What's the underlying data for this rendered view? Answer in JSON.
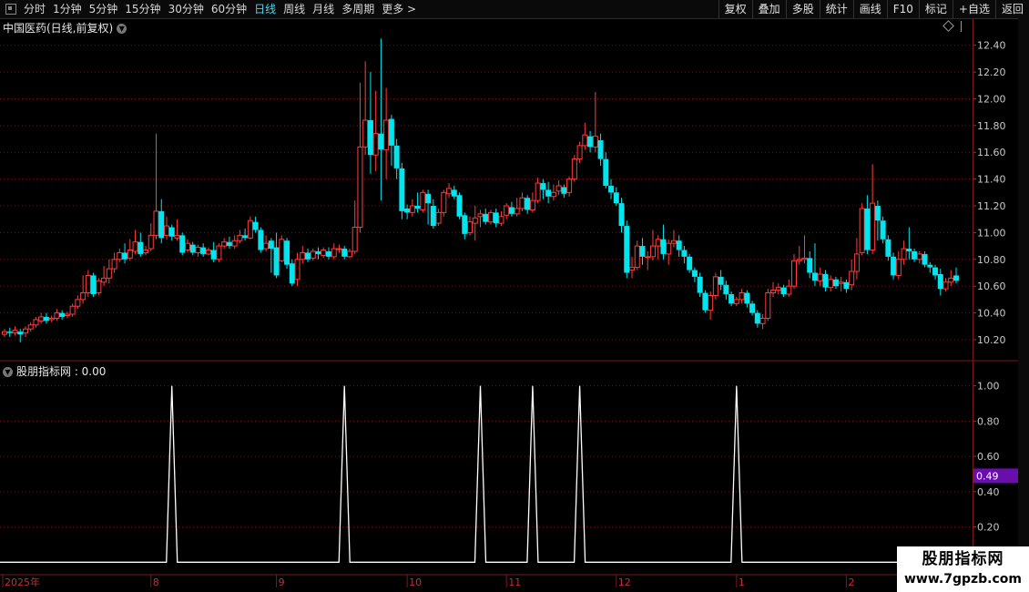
{
  "toolbar": {
    "periods": [
      "分时",
      "1分钟",
      "5分钟",
      "15分钟",
      "30分钟",
      "60分钟",
      "日线",
      "周线",
      "月线",
      "多周期",
      "更多 >"
    ],
    "active_index": 6,
    "buttons": [
      "复权",
      "叠加",
      "多股",
      "统计",
      "画线",
      "F10",
      "标记",
      "+自选",
      "返回"
    ]
  },
  "main_title": "中国医药(日线,前复权)",
  "indicator_title": "股朋指标网 : 0.00",
  "watermark": {
    "line1": "股朋指标网",
    "line2": "www.7gpzb.com"
  },
  "colors": {
    "up": "#ff3c3c",
    "down": "#00e5ee",
    "grid": "#6e1414",
    "signal": "#ffffff",
    "cursor_badge": "#6a0dad"
  },
  "chart_data": [
    {
      "type": "candlestick",
      "y_ticks": [
        "12.40",
        "12.20",
        "12.00",
        "11.80",
        "11.60",
        "11.40",
        "11.20",
        "11.00",
        "10.80",
        "10.60",
        "10.40",
        "10.20"
      ],
      "ylim": [
        10.05,
        12.5
      ],
      "candles": [
        [
          10.24,
          10.26,
          10.28,
          10.22
        ],
        [
          10.26,
          10.25,
          10.29,
          10.22
        ],
        [
          10.25,
          10.27,
          10.3,
          10.23
        ],
        [
          10.26,
          10.24,
          10.28,
          10.18
        ],
        [
          10.25,
          10.28,
          10.3,
          10.22
        ],
        [
          10.28,
          10.31,
          10.33,
          10.26
        ],
        [
          10.31,
          10.35,
          10.37,
          10.29
        ],
        [
          10.34,
          10.37,
          10.4,
          10.32
        ],
        [
          10.37,
          10.34,
          10.4,
          10.32
        ],
        [
          10.35,
          10.36,
          10.38,
          10.33
        ],
        [
          10.36,
          10.4,
          10.43,
          10.34
        ],
        [
          10.4,
          10.37,
          10.42,
          10.35
        ],
        [
          10.38,
          10.39,
          10.41,
          10.36
        ],
        [
          10.39,
          10.45,
          10.47,
          10.37
        ],
        [
          10.45,
          10.5,
          10.53,
          10.43
        ],
        [
          10.5,
          10.55,
          10.68,
          10.47
        ],
        [
          10.55,
          10.68,
          10.72,
          10.52
        ],
        [
          10.68,
          10.54,
          10.7,
          10.52
        ],
        [
          10.55,
          10.64,
          10.66,
          10.53
        ],
        [
          10.63,
          10.66,
          10.75,
          10.6
        ],
        [
          10.66,
          10.73,
          10.8,
          10.62
        ],
        [
          10.73,
          10.8,
          10.85,
          10.7
        ],
        [
          10.8,
          10.85,
          10.88,
          10.78
        ],
        [
          10.85,
          10.8,
          10.92,
          10.77
        ],
        [
          10.81,
          10.87,
          10.95,
          10.79
        ],
        [
          10.86,
          10.93,
          11.02,
          10.84
        ],
        [
          10.93,
          10.84,
          11.0,
          10.82
        ],
        [
          10.85,
          10.87,
          10.9,
          10.83
        ],
        [
          10.88,
          10.98,
          11.07,
          10.86
        ],
        [
          10.98,
          11.16,
          11.74,
          10.95
        ],
        [
          11.16,
          10.96,
          11.25,
          10.92
        ],
        [
          10.98,
          11.05,
          11.12,
          10.95
        ],
        [
          11.04,
          10.97,
          11.06,
          10.94
        ],
        [
          10.96,
          10.98,
          11.1,
          10.94
        ],
        [
          10.98,
          10.85,
          11.0,
          10.83
        ],
        [
          10.87,
          10.92,
          10.95,
          10.85
        ],
        [
          10.91,
          10.85,
          10.93,
          10.83
        ],
        [
          10.85,
          10.89,
          10.91,
          10.82
        ],
        [
          10.89,
          10.84,
          10.92,
          10.82
        ],
        [
          10.84,
          10.87,
          10.89,
          10.83
        ],
        [
          10.87,
          10.8,
          10.93,
          10.78
        ],
        [
          10.8,
          10.9,
          10.92,
          10.78
        ],
        [
          10.9,
          10.93,
          10.96,
          10.88
        ],
        [
          10.93,
          10.9,
          10.97,
          10.88
        ],
        [
          10.9,
          10.94,
          10.98,
          10.88
        ],
        [
          10.94,
          10.98,
          11.02,
          10.92
        ],
        [
          10.98,
          10.96,
          11.03,
          10.94
        ],
        [
          10.96,
          11.09,
          11.12,
          10.95
        ],
        [
          11.08,
          11.02,
          11.12,
          11.0
        ],
        [
          11.02,
          10.87,
          11.04,
          10.85
        ],
        [
          10.88,
          10.92,
          10.98,
          10.86
        ],
        [
          10.94,
          10.88,
          10.96,
          10.7
        ],
        [
          10.89,
          10.68,
          11.0,
          10.66
        ],
        [
          10.79,
          10.95,
          10.98,
          10.78
        ],
        [
          10.94,
          10.76,
          10.96,
          10.73
        ],
        [
          10.77,
          10.62,
          10.8,
          10.6
        ],
        [
          10.65,
          10.8,
          10.85,
          10.6
        ],
        [
          10.8,
          10.85,
          10.9,
          10.77
        ],
        [
          10.85,
          10.8,
          10.88,
          10.78
        ],
        [
          10.81,
          10.86,
          10.88,
          10.79
        ],
        [
          10.86,
          10.84,
          10.89,
          10.8
        ],
        [
          10.83,
          10.87,
          10.89,
          10.81
        ],
        [
          10.86,
          10.82,
          10.89,
          10.8
        ],
        [
          10.82,
          10.88,
          10.92,
          10.8
        ],
        [
          10.88,
          10.88,
          10.91,
          10.85
        ],
        [
          10.88,
          10.82,
          10.9,
          10.8
        ],
        [
          10.82,
          10.86,
          10.88,
          10.81
        ],
        [
          10.86,
          11.04,
          11.24,
          10.84
        ],
        [
          11.04,
          11.64,
          12.12,
          11.0
        ],
        [
          11.64,
          11.84,
          12.28,
          11.58
        ],
        [
          11.84,
          11.58,
          12.2,
          11.44
        ],
        [
          11.58,
          11.74,
          12.06,
          11.46
        ],
        [
          11.74,
          11.62,
          12.45,
          11.24
        ],
        [
          11.62,
          11.84,
          12.08,
          11.4
        ],
        [
          11.85,
          11.65,
          11.88,
          11.5
        ],
        [
          11.65,
          11.48,
          11.7,
          11.4
        ],
        [
          11.48,
          11.16,
          11.52,
          11.1
        ],
        [
          11.18,
          11.15,
          11.21,
          11.1
        ],
        [
          11.15,
          11.2,
          11.25,
          11.12
        ],
        [
          11.2,
          11.18,
          11.3,
          11.15
        ],
        [
          11.17,
          11.3,
          11.32,
          11.15
        ],
        [
          11.29,
          11.22,
          11.32,
          11.06
        ],
        [
          11.2,
          11.05,
          11.25,
          11.03
        ],
        [
          11.07,
          11.15,
          11.18,
          11.05
        ],
        [
          11.15,
          11.3,
          11.32,
          11.12
        ],
        [
          11.29,
          11.33,
          11.37,
          11.26
        ],
        [
          11.32,
          11.27,
          11.35,
          11.25
        ],
        [
          11.28,
          11.12,
          11.3,
          11.1
        ],
        [
          11.13,
          10.99,
          11.15,
          10.95
        ],
        [
          11.0,
          11.08,
          11.12,
          10.98
        ],
        [
          11.07,
          11.11,
          11.2,
          10.94
        ],
        [
          11.12,
          11.14,
          11.17,
          11.04
        ],
        [
          11.14,
          11.08,
          11.18,
          11.06
        ],
        [
          11.08,
          11.15,
          11.17,
          11.06
        ],
        [
          11.15,
          11.07,
          11.18,
          11.04
        ],
        [
          11.07,
          11.12,
          11.16,
          11.05
        ],
        [
          11.13,
          11.2,
          11.22,
          11.1
        ],
        [
          11.19,
          11.14,
          11.23,
          11.12
        ],
        [
          11.14,
          11.18,
          11.26,
          11.12
        ],
        [
          11.18,
          11.26,
          11.3,
          11.16
        ],
        [
          11.26,
          11.17,
          11.28,
          11.14
        ],
        [
          11.17,
          11.24,
          11.3,
          11.15
        ],
        [
          11.24,
          11.37,
          11.41,
          11.22
        ],
        [
          11.37,
          11.32,
          11.4,
          11.25
        ],
        [
          11.32,
          11.27,
          11.38,
          11.22
        ],
        [
          11.27,
          11.3,
          11.36,
          11.24
        ],
        [
          11.31,
          11.35,
          11.39,
          11.28
        ],
        [
          11.34,
          11.29,
          11.36,
          11.26
        ],
        [
          11.3,
          11.4,
          11.42,
          11.27
        ],
        [
          11.4,
          11.55,
          11.58,
          11.38
        ],
        [
          11.55,
          11.65,
          11.68,
          11.52
        ],
        [
          11.65,
          11.73,
          11.82,
          11.62
        ],
        [
          11.72,
          11.64,
          11.76,
          11.6
        ],
        [
          11.64,
          11.72,
          12.05,
          11.6
        ],
        [
          11.69,
          11.55,
          11.74,
          11.5
        ],
        [
          11.55,
          11.35,
          11.6,
          11.33
        ],
        [
          11.35,
          11.3,
          11.4,
          11.25
        ],
        [
          11.3,
          11.22,
          11.34,
          11.2
        ],
        [
          11.22,
          11.05,
          11.26,
          11.0
        ],
        [
          11.05,
          10.7,
          11.09,
          10.66
        ],
        [
          10.72,
          10.74,
          10.82,
          10.66
        ],
        [
          10.74,
          10.9,
          10.94,
          10.72
        ],
        [
          10.9,
          10.82,
          10.96,
          10.76
        ],
        [
          10.82,
          10.82,
          10.86,
          10.72
        ],
        [
          10.82,
          10.9,
          11.02,
          10.79
        ],
        [
          10.9,
          10.95,
          10.98,
          10.8
        ],
        [
          10.95,
          10.84,
          11.06,
          10.8
        ],
        [
          10.84,
          10.92,
          10.95,
          10.76
        ],
        [
          10.92,
          10.94,
          11.02,
          10.89
        ],
        [
          10.94,
          10.87,
          10.98,
          10.82
        ],
        [
          10.87,
          10.82,
          10.9,
          10.77
        ],
        [
          10.82,
          10.72,
          10.84,
          10.7
        ],
        [
          10.72,
          10.67,
          10.74,
          10.63
        ],
        [
          10.67,
          10.55,
          10.7,
          10.52
        ],
        [
          10.55,
          10.42,
          10.57,
          10.4
        ],
        [
          10.42,
          10.53,
          10.56,
          10.35
        ],
        [
          10.53,
          10.67,
          10.7,
          10.5
        ],
        [
          10.67,
          10.61,
          10.72,
          10.57
        ],
        [
          10.61,
          10.54,
          10.64,
          10.5
        ],
        [
          10.54,
          10.47,
          10.56,
          10.45
        ],
        [
          10.47,
          10.5,
          10.52,
          10.45
        ],
        [
          10.5,
          10.55,
          10.58,
          10.47
        ],
        [
          10.55,
          10.47,
          10.57,
          10.44
        ],
        [
          10.47,
          10.4,
          10.49,
          10.38
        ],
        [
          10.4,
          10.32,
          10.42,
          10.29
        ],
        [
          10.32,
          10.36,
          10.39,
          10.28
        ],
        [
          10.36,
          10.55,
          10.58,
          10.34
        ],
        [
          10.55,
          10.57,
          10.63,
          10.52
        ],
        [
          10.57,
          10.59,
          10.62,
          10.54
        ],
        [
          10.59,
          10.54,
          10.61,
          10.52
        ],
        [
          10.54,
          10.6,
          10.65,
          10.52
        ],
        [
          10.6,
          10.79,
          10.84,
          10.58
        ],
        [
          10.79,
          10.8,
          10.9,
          10.76
        ],
        [
          10.8,
          10.81,
          10.98,
          10.77
        ],
        [
          10.81,
          10.7,
          10.86,
          10.66
        ],
        [
          10.7,
          10.64,
          10.92,
          10.6
        ],
        [
          10.64,
          10.69,
          10.74,
          10.6
        ],
        [
          10.69,
          10.59,
          10.72,
          10.56
        ],
        [
          10.59,
          10.65,
          10.68,
          10.56
        ],
        [
          10.65,
          10.6,
          10.67,
          10.58
        ],
        [
          10.62,
          10.63,
          10.67,
          10.56
        ],
        [
          10.63,
          10.58,
          10.65,
          10.55
        ],
        [
          10.61,
          10.71,
          10.8,
          10.57
        ],
        [
          10.71,
          10.84,
          10.96,
          10.65
        ],
        [
          10.85,
          11.18,
          11.22,
          10.83
        ],
        [
          11.18,
          10.87,
          11.28,
          10.84
        ],
        [
          10.87,
          11.22,
          11.51,
          10.84
        ],
        [
          11.2,
          11.09,
          11.24,
          10.94
        ],
        [
          11.09,
          10.95,
          11.12,
          10.92
        ],
        [
          10.95,
          10.82,
          10.98,
          10.79
        ],
        [
          10.82,
          10.68,
          10.85,
          10.65
        ],
        [
          10.68,
          10.8,
          10.86,
          10.65
        ],
        [
          10.8,
          10.88,
          10.94,
          10.76
        ],
        [
          10.88,
          10.86,
          11.04,
          10.8
        ],
        [
          10.86,
          10.8,
          10.88,
          10.78
        ],
        [
          10.8,
          10.84,
          10.86,
          10.77
        ],
        [
          10.84,
          10.76,
          10.86,
          10.74
        ],
        [
          10.76,
          10.74,
          10.78,
          10.7
        ],
        [
          10.74,
          10.68,
          10.76,
          10.65
        ],
        [
          10.69,
          10.58,
          10.73,
          10.53
        ],
        [
          10.58,
          10.63,
          10.66,
          10.56
        ],
        [
          10.63,
          10.66,
          10.72,
          10.6
        ],
        [
          10.68,
          10.64,
          10.74,
          10.62
        ]
      ]
    },
    {
      "type": "line",
      "name": "股朋指标网",
      "y_ticks": [
        "1.00",
        "0.80",
        "0.60",
        "0.40",
        "0.20"
      ],
      "ylim": [
        -0.05,
        1.06
      ],
      "cursor_value": "0.49",
      "spikes_at_index": [
        32,
        65,
        91,
        101,
        110,
        140
      ],
      "x_labels": [
        "2025年",
        "8",
        "9",
        "10",
        "11",
        "12",
        "1",
        "2"
      ]
    }
  ]
}
